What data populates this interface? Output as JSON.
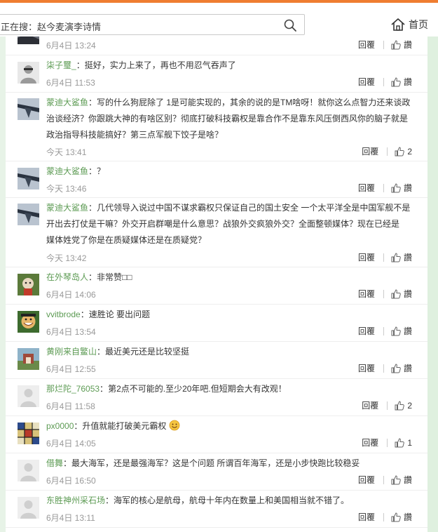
{
  "search": {
    "text": "正在搜：赵今麦演李诗情"
  },
  "header": {
    "home_label": "首页"
  },
  "colors": {
    "accent": "#ef7d31",
    "username": "#5d9b54",
    "time": "#999999",
    "sidebar_green": "#dff0df"
  },
  "comments": [
    {
      "user": "",
      "sep": "",
      "text": "",
      "time": "6月4日 13:24",
      "reply": "回覆",
      "likes": "讚"
    },
    {
      "user": "柒子璽_",
      "sep": "：",
      "text": "挺好，实力上来了，再也不用忍气吞声了",
      "time": "6月4日 11:53",
      "reply": "回覆",
      "likes": "讚"
    },
    {
      "user": "蒙迪大鲨鱼",
      "sep": "：",
      "text": "写的什么狗屁除了 1是可能实现的，其余的说的是TM啥呀！就你这么点智力还来谈政",
      "text2": "治谈经济？你跟跳大神的有啥区别？彻底打破科技霸权是靠合作不是靠东风压倒西风你的脑子就是",
      "text3": "政治指导科技能搞好？第三点军舰下饺子是啥？",
      "time": "今天 13:41",
      "reply": "回覆",
      "likes": "2"
    },
    {
      "user": "蒙迪大鲨鱼",
      "sep": "：",
      "text": "？",
      "time": "今天 13:46",
      "reply": "回覆",
      "likes": "讚"
    },
    {
      "user": "蒙迪大鲨鱼",
      "sep": "：",
      "text": "几代领导入说过中国不谋求霸权只保证自己的国土安全 一个太平洋全是中国军舰不是",
      "text2": "开出去打仗是干嘛？外交开启群嘲是什么意思？战狼外交疯狼外交？全面整顿媒体？现在已经是",
      "text3": "媒体姓党了你是在质疑媒体还是在质疑党？",
      "time": "今天 13:42",
      "reply": "回覆",
      "likes": "讚"
    },
    {
      "user": "在外琴岛人",
      "sep": "：",
      "text": "非常赞□□",
      "time": "6月4日 14:06",
      "reply": "回覆",
      "likes": "讚"
    },
    {
      "user": "vvitbrode",
      "sep": "：",
      "text": "速胜论 要出问题",
      "time": "6月4日 13:54",
      "reply": "回覆",
      "likes": "讚"
    },
    {
      "user": "黄刚来自鳘山",
      "sep": "：",
      "text": "最近美元还是比较坚挺",
      "time": "6月4日 12:55",
      "reply": "回覆",
      "likes": "讚"
    },
    {
      "user": "那烂陀_76053",
      "sep": "：",
      "text": "第2点不可能的.至少20年吧.但短期会大有改观！",
      "time": "6月4日 11:58",
      "reply": "回覆",
      "likes": "2"
    },
    {
      "user": "px0000",
      "sep": "：",
      "text": "升值就能打破美元霸权",
      "time": "6月4日 14:05",
      "reply": "回覆",
      "likes": "1"
    },
    {
      "user": "借舞",
      "sep": "：",
      "text": "最大海军，还是最强海军？这是个问题 所谓百年海军，还是小步快跑比较稳妥",
      "time": "6月4日 16:50",
      "reply": "回覆",
      "likes": "讚"
    },
    {
      "user": "东胜神州采石场",
      "sep": "：",
      "text": "海军的核心是航母，航母十年内在数量上和美国相当就不错了。",
      "time": "6月4日 13:11",
      "reply": "回覆",
      "likes": "讚"
    }
  ]
}
